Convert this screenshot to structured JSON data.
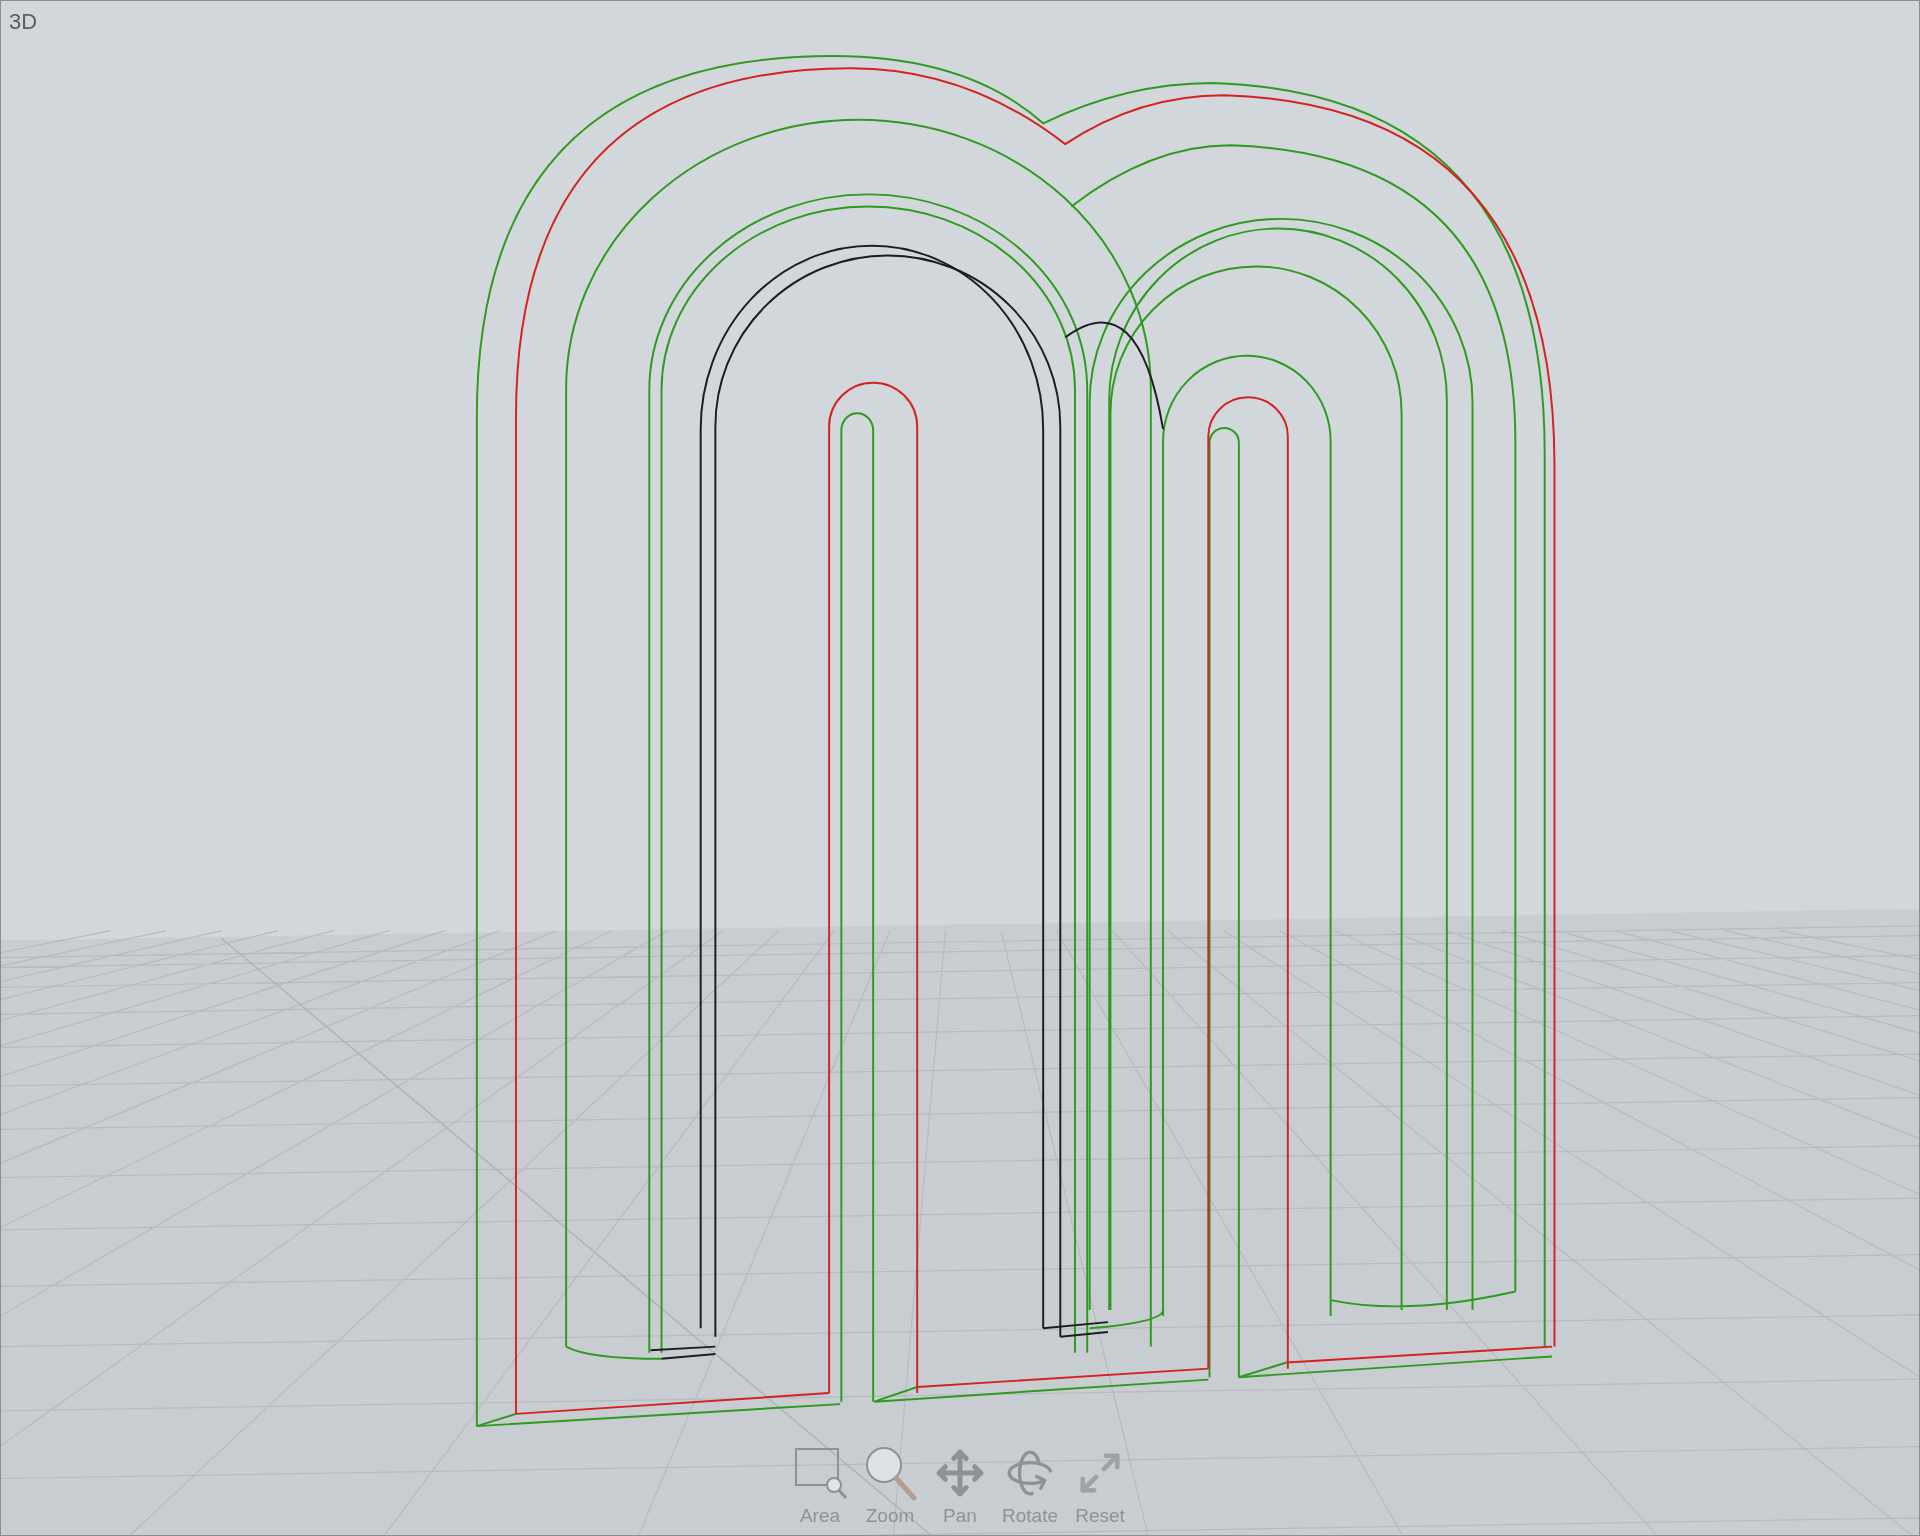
{
  "viewport": {
    "label": "3D"
  },
  "toolbar": {
    "tools": [
      {
        "kind": "area",
        "label": "Area"
      },
      {
        "kind": "zoom",
        "label": "Zoom"
      },
      {
        "kind": "pan",
        "label": "Pan"
      },
      {
        "kind": "rotate",
        "label": "Rotate"
      },
      {
        "kind": "reset",
        "label": "Reset"
      }
    ]
  }
}
